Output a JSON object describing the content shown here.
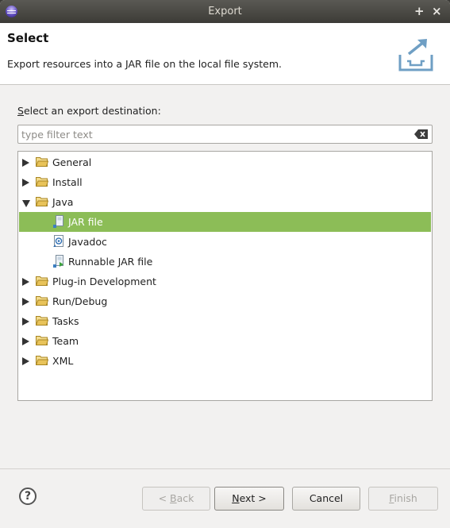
{
  "window": {
    "title": "Export",
    "controls": [
      "+",
      "×"
    ]
  },
  "header": {
    "title": "Select",
    "description": "Export resources into a JAR file on the local file system.",
    "icon": "export-wizard-icon"
  },
  "destination": {
    "label_mnemonic": "S",
    "label_rest": "elect an export destination:",
    "filter_placeholder": "type filter text",
    "filter_value": ""
  },
  "tree": {
    "items": [
      {
        "label": "General",
        "type": "folder",
        "expanded": false
      },
      {
        "label": "Install",
        "type": "folder",
        "expanded": false
      },
      {
        "label": "Java",
        "type": "folder",
        "expanded": true
      },
      {
        "label": "JAR file",
        "type": "jar",
        "selected": true
      },
      {
        "label": "Javadoc",
        "type": "javadoc"
      },
      {
        "label": "Runnable JAR file",
        "type": "runnable-jar"
      },
      {
        "label": "Plug-in Development",
        "type": "folder",
        "expanded": false
      },
      {
        "label": "Run/Debug",
        "type": "folder",
        "expanded": false
      },
      {
        "label": "Tasks",
        "type": "folder",
        "expanded": false
      },
      {
        "label": "Team",
        "type": "folder",
        "expanded": false
      },
      {
        "label": "XML",
        "type": "folder",
        "expanded": false
      }
    ]
  },
  "buttons": {
    "help": "?",
    "back_prefix": "< ",
    "back_mnemonic": "B",
    "back_rest": "ack",
    "next_mnemonic": "N",
    "next_rest": "ext >",
    "cancel": "Cancel",
    "finish_mnemonic": "F",
    "finish_rest": "inish"
  },
  "colors": {
    "selection": "#8cbd57",
    "titlebar": "#3c3b37",
    "folder": "#e8c35a"
  }
}
